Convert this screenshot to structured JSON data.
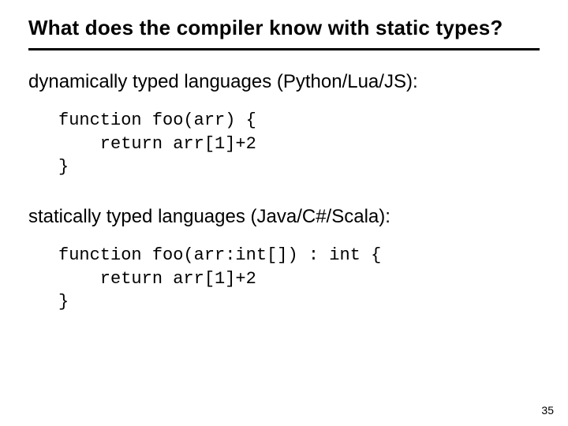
{
  "title": "What does the compiler know with static types?",
  "dynamic": {
    "label": "dynamically typed languages (Python/Lua/JS):",
    "code": "function foo(arr) {\n    return arr[1]+2\n}"
  },
  "static": {
    "label": "statically typed languages (Java/C#/Scala):",
    "code": "function foo(arr:int[]) : int {\n    return arr[1]+2\n}"
  },
  "page_number": "35"
}
